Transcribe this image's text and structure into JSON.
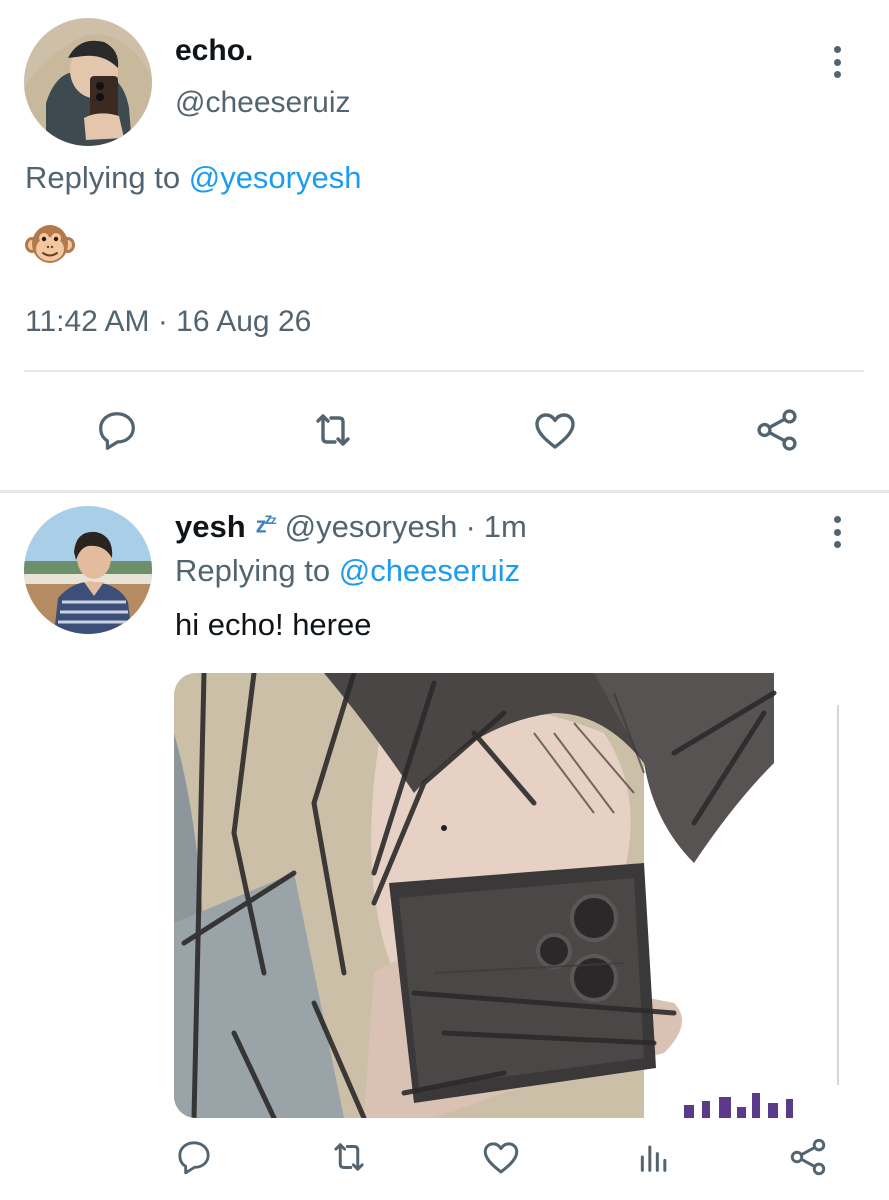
{
  "main_tweet": {
    "display_name": "echo.",
    "handle": "@cheeseruiz",
    "replying_prefix": "Replying to ",
    "replying_handle": "@yesoryesh",
    "body_emoji": "monkey-face",
    "timestamp": "11:42 AM · 16 Aug 26",
    "actions": [
      "reply-icon",
      "retweet-icon",
      "like-icon",
      "share-icon"
    ]
  },
  "reply_tweet": {
    "display_name": "yesh",
    "name_emoji": "zzz",
    "handle": "@yesoryesh",
    "separator": "·",
    "time_ago": "1m",
    "replying_prefix": "Replying to ",
    "replying_handle": "@cheeseruiz",
    "text": "hi echo! heree",
    "media": "sketch-drawing",
    "actions": [
      "reply-icon",
      "retweet-icon",
      "like-icon",
      "analytics-icon",
      "share-icon"
    ]
  },
  "colors": {
    "accent": "#1d9bf0",
    "secondary_text": "#536471",
    "primary_text": "#0f1419",
    "divider": "#e4e8eb"
  }
}
